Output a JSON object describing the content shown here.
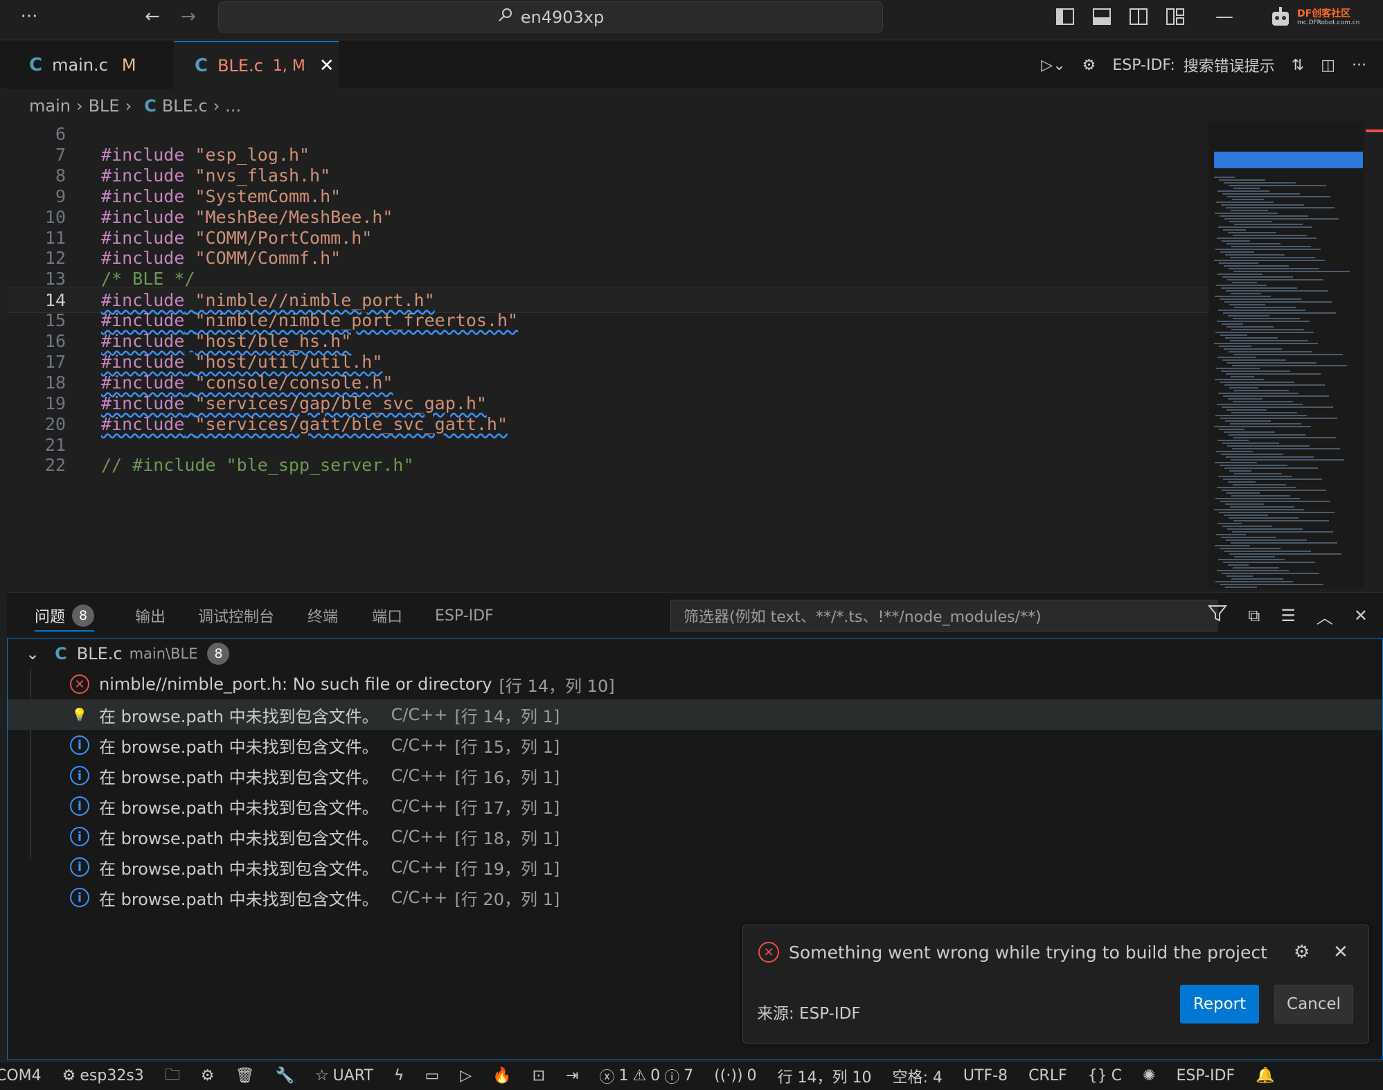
{
  "titlebar": {
    "menu_icon": "more-icon",
    "search_text": "en4903xp",
    "logo_text": "DF创客社区",
    "logo_sub": "mc.DFRobot.com.cn"
  },
  "tabs": [
    {
      "name": "main.c",
      "status": "M"
    },
    {
      "name": "BLE.c",
      "status": "1, M"
    }
  ],
  "editor_actions": {
    "esp_idf_label": "ESP-IDF:",
    "search_errors": "搜索错误提示"
  },
  "breadcrumb": [
    "main",
    "BLE",
    "BLE.c",
    "..."
  ],
  "code_lines": [
    {
      "n": "6",
      "parts": [
        {
          "t": "",
          "c": ""
        }
      ]
    },
    {
      "n": "7",
      "parts": [
        {
          "t": "#include",
          "c": "kw"
        },
        {
          "t": " ",
          "c": ""
        },
        {
          "t": "\"esp_log.h\"",
          "c": "str"
        }
      ]
    },
    {
      "n": "8",
      "parts": [
        {
          "t": "#include",
          "c": "kw"
        },
        {
          "t": " ",
          "c": ""
        },
        {
          "t": "\"nvs_flash.h\"",
          "c": "str"
        }
      ]
    },
    {
      "n": "9",
      "parts": [
        {
          "t": "#include",
          "c": "kw"
        },
        {
          "t": " ",
          "c": ""
        },
        {
          "t": "\"SystemComm.h\"",
          "c": "str"
        }
      ]
    },
    {
      "n": "10",
      "parts": [
        {
          "t": "#include",
          "c": "kw"
        },
        {
          "t": " ",
          "c": ""
        },
        {
          "t": "\"MeshBee/MeshBee.h\"",
          "c": "str"
        }
      ]
    },
    {
      "n": "11",
      "parts": [
        {
          "t": "#include",
          "c": "kw"
        },
        {
          "t": " ",
          "c": ""
        },
        {
          "t": "\"COMM/PortComm.h\"",
          "c": "str"
        }
      ]
    },
    {
      "n": "12",
      "parts": [
        {
          "t": "#include",
          "c": "kw"
        },
        {
          "t": " ",
          "c": ""
        },
        {
          "t": "\"COMM/Commf.h\"",
          "c": "str"
        }
      ]
    },
    {
      "n": "13",
      "parts": [
        {
          "t": "/* BLE */",
          "c": "cm"
        }
      ]
    },
    {
      "n": "14",
      "active": true,
      "parts": [
        {
          "t": "#include",
          "c": "kw squig"
        },
        {
          "t": " ",
          "c": "squig"
        },
        {
          "t": "\"nimble//nimble_port.h\"",
          "c": "str squig"
        }
      ]
    },
    {
      "n": "15",
      "parts": [
        {
          "t": "#include",
          "c": "kw squig"
        },
        {
          "t": " ",
          "c": "squig"
        },
        {
          "t": "\"nimble/nimble_port_freertos.h\"",
          "c": "str squig"
        }
      ]
    },
    {
      "n": "16",
      "parts": [
        {
          "t": "#include",
          "c": "kw squig"
        },
        {
          "t": " ",
          "c": "squig"
        },
        {
          "t": "\"host/ble_hs.h\"",
          "c": "str squig"
        }
      ]
    },
    {
      "n": "17",
      "parts": [
        {
          "t": "#include",
          "c": "kw squig"
        },
        {
          "t": " ",
          "c": "squig"
        },
        {
          "t": "\"host/util/util.h\"",
          "c": "str squig"
        }
      ]
    },
    {
      "n": "18",
      "parts": [
        {
          "t": "#include",
          "c": "kw squig"
        },
        {
          "t": " ",
          "c": "squig"
        },
        {
          "t": "\"console/console.h\"",
          "c": "str squig"
        }
      ]
    },
    {
      "n": "19",
      "parts": [
        {
          "t": "#include",
          "c": "kw squig"
        },
        {
          "t": " ",
          "c": "squig"
        },
        {
          "t": "\"services/gap/ble_svc_gap.h\"",
          "c": "str squig"
        }
      ]
    },
    {
      "n": "20",
      "parts": [
        {
          "t": "#include",
          "c": "kw squig"
        },
        {
          "t": " ",
          "c": "squig"
        },
        {
          "t": "\"services/gatt/ble_svc_gatt.h\"",
          "c": "str squig"
        }
      ]
    },
    {
      "n": "21",
      "parts": [
        {
          "t": "",
          "c": ""
        }
      ]
    },
    {
      "n": "22",
      "parts": [
        {
          "t": "// #include \"ble_spp_server.h\"",
          "c": "cm"
        }
      ]
    }
  ],
  "panel": {
    "tabs": [
      "问题",
      "输出",
      "调试控制台",
      "终端",
      "端口",
      "ESP-IDF"
    ],
    "problems_count": "8",
    "filter_placeholder": "筛选器(例如 text、**/*.ts、!**/node_modules/**)"
  },
  "problems": {
    "file": "BLE.c",
    "path": "main\\BLE",
    "count": "8",
    "items": [
      {
        "type": "error",
        "msg": "nimble//nimble_port.h: No such file or directory",
        "src": "",
        "loc": "[行 14，列 10]"
      },
      {
        "type": "hint",
        "msg": "在 browse.path 中未找到包含文件。",
        "src": "C/C++",
        "loc": "[行 14，列 1]"
      },
      {
        "type": "info",
        "msg": "在 browse.path 中未找到包含文件。",
        "src": "C/C++",
        "loc": "[行 15，列 1]"
      },
      {
        "type": "info",
        "msg": "在 browse.path 中未找到包含文件。",
        "src": "C/C++",
        "loc": "[行 16，列 1]"
      },
      {
        "type": "info",
        "msg": "在 browse.path 中未找到包含文件。",
        "src": "C/C++",
        "loc": "[行 17，列 1]"
      },
      {
        "type": "info",
        "msg": "在 browse.path 中未找到包含文件。",
        "src": "C/C++",
        "loc": "[行 18，列 1]"
      },
      {
        "type": "info",
        "msg": "在 browse.path 中未找到包含文件。",
        "src": "C/C++",
        "loc": "[行 19，列 1]"
      },
      {
        "type": "info",
        "msg": "在 browse.path 中未找到包含文件。",
        "src": "C/C++",
        "loc": "[行 20，列 1]"
      }
    ]
  },
  "notification": {
    "message": "Something went wrong while trying to build the project",
    "source": "来源: ESP-IDF",
    "report": "Report",
    "cancel": "Cancel"
  },
  "statusbar": {
    "port": "COM4",
    "target": "esp32s3",
    "uart": "UART",
    "errors": "1",
    "warnings": "0",
    "infos": "7",
    "ports": "0",
    "position": "行 14，列 10",
    "spaces": "空格: 4",
    "encoding": "UTF-8",
    "eol": "CRLF",
    "language": "C",
    "esp_idf": "ESP-IDF"
  },
  "colors": {
    "accent": "#0078d4",
    "error": "#f14c4c",
    "info": "#3794ff",
    "keyword": "#c586c0",
    "string": "#ce9178",
    "comment": "#6a9955"
  }
}
